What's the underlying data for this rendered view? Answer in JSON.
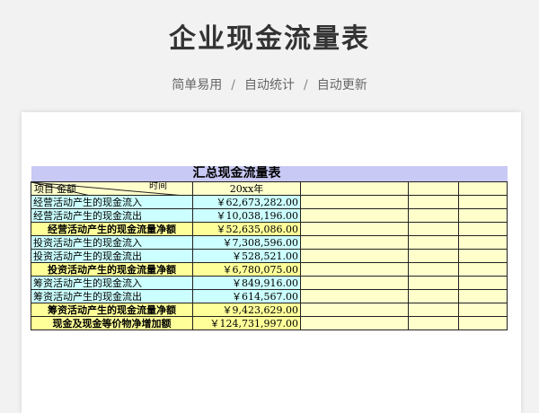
{
  "page": {
    "title": "企业现金流量表",
    "tags": [
      "简单易用",
      "自动统计",
      "自动更新"
    ]
  },
  "sheet": {
    "title": "汇总现金流量表",
    "header": {
      "item": "项目",
      "amount": "金额",
      "time": "时间",
      "period": "20xx年"
    },
    "rows": [
      {
        "label": "经营活动产生的现金流入",
        "value": "￥62,673,282.00",
        "style": "c"
      },
      {
        "label": "经营活动产生的现金流出",
        "value": "￥10,038,196.00",
        "style": "c"
      },
      {
        "label": "经营活动产生的现金流量净额",
        "value": "￥52,635,086.00",
        "style": "g"
      },
      {
        "label": "投资活动产生的现金流入",
        "value": "￥7,308,596.00",
        "style": "c"
      },
      {
        "label": "投资活动产生的现金流出",
        "value": "￥528,521.00",
        "style": "c"
      },
      {
        "label": "投资活动产生的现金流量净额",
        "value": "￥6,780,075.00",
        "style": "g"
      },
      {
        "label": "筹资活动产生的现金流入",
        "value": "￥849,916.00",
        "style": "c"
      },
      {
        "label": "筹资活动产生的现金流出",
        "value": "￥614,567.00",
        "style": "c"
      },
      {
        "label": "筹资活动产生的现金流量净额",
        "value": "￥9,423,629.00",
        "style": "g"
      },
      {
        "label": "现金及现金等价物净增加额",
        "value": "￥124,731,997.00",
        "style": "g"
      }
    ]
  },
  "colors": {
    "title_bar": "#c9c9f5",
    "inflow_outflow": "#ccffff",
    "net_row": "#ffff99",
    "empty_cell": "#ffffcc"
  }
}
